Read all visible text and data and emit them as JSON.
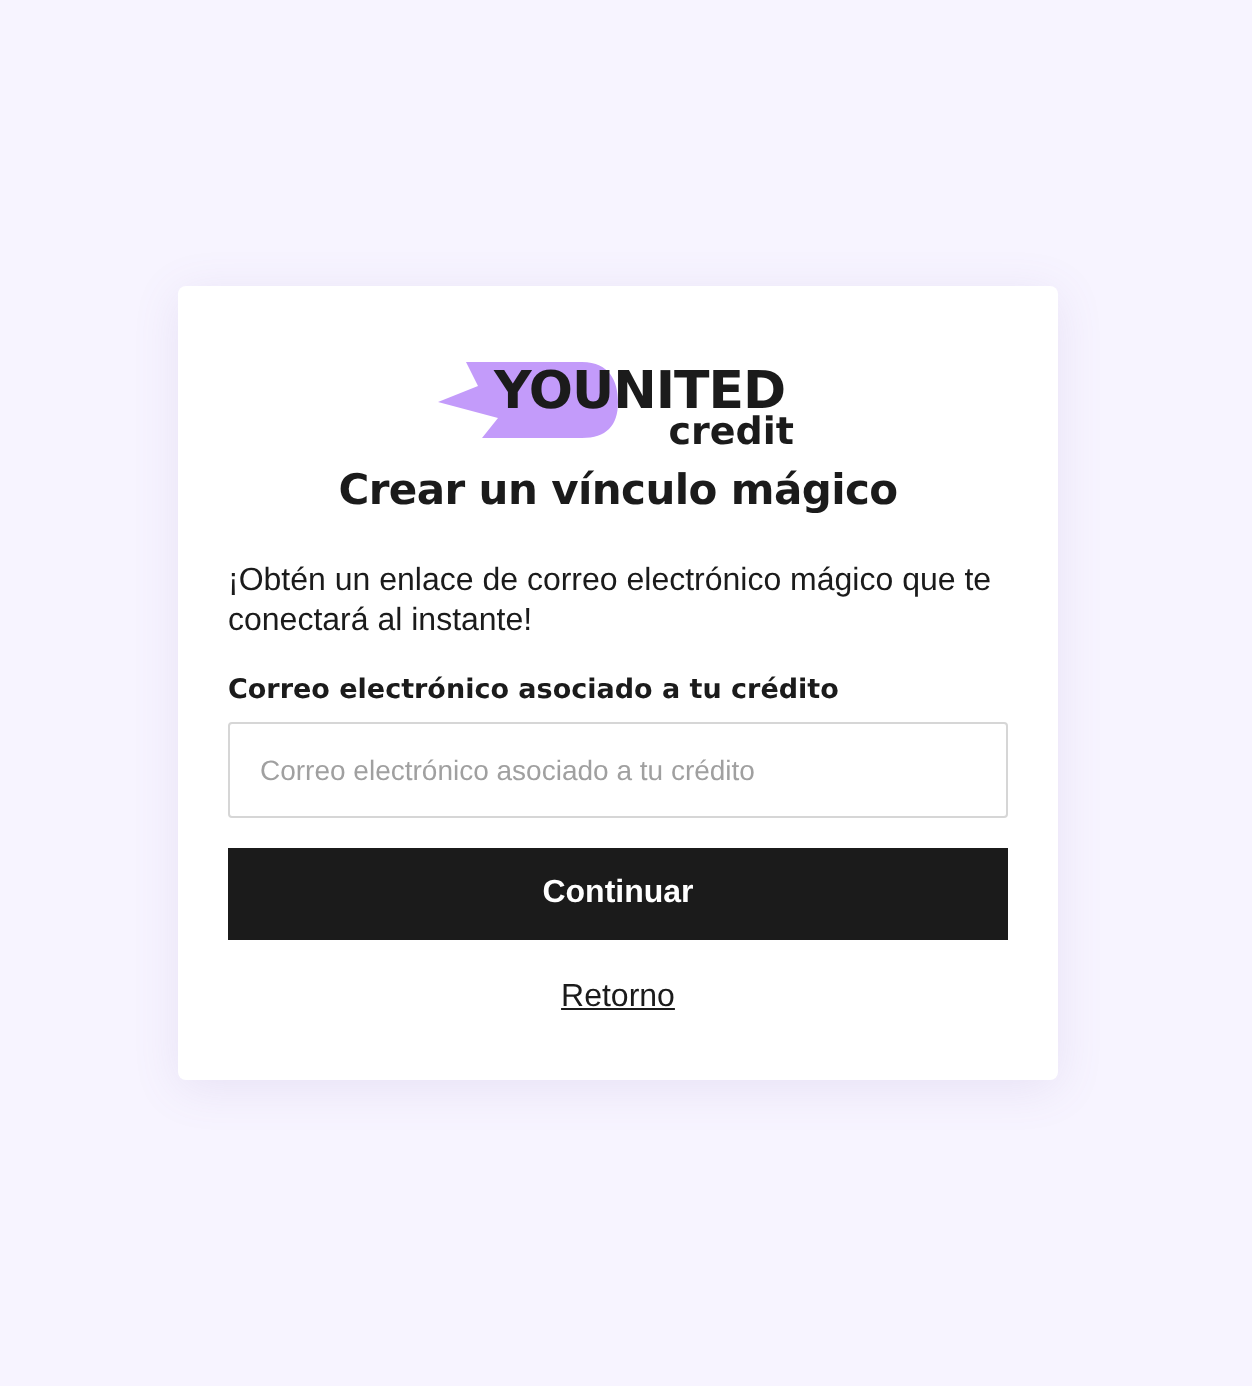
{
  "logo": {
    "wordmark": "YOUNITED",
    "subtitle": "credit"
  },
  "title": "Crear un vínculo mágico",
  "intro": "¡Obtén un enlace de correo electrónico mágico que te conectará al instante!",
  "email_field": {
    "label": "Correo electrónico asociado a tu crédito",
    "placeholder": "Correo electrónico asociado a tu crédito"
  },
  "buttons": [
    {
      "kind": "primary",
      "label": "Continuar"
    },
    {
      "kind": "link",
      "label": "Retorno"
    }
  ]
}
